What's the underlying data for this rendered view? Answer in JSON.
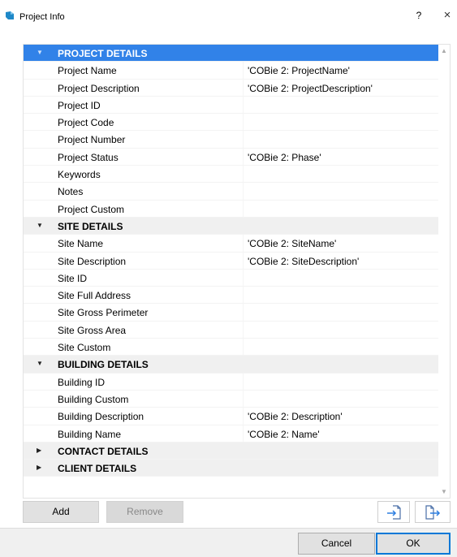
{
  "window": {
    "title": "Project Info",
    "help_label": "?",
    "close_label": "×"
  },
  "grid": {
    "sections": [
      {
        "title": "PROJECT DETAILS",
        "expanded": true,
        "selected": true,
        "rows": [
          {
            "label": "Project Name",
            "value": "'COBie 2: ProjectName'"
          },
          {
            "label": "Project Description",
            "value": "'COBie 2: ProjectDescription'"
          },
          {
            "label": "Project ID",
            "value": ""
          },
          {
            "label": "Project Code",
            "value": ""
          },
          {
            "label": "Project Number",
            "value": ""
          },
          {
            "label": "Project Status",
            "value": "'COBie 2: Phase'"
          },
          {
            "label": "Keywords",
            "value": ""
          },
          {
            "label": "Notes",
            "value": ""
          },
          {
            "label": "Project Custom",
            "value": ""
          }
        ]
      },
      {
        "title": "SITE DETAILS",
        "expanded": true,
        "selected": false,
        "rows": [
          {
            "label": "Site Name",
            "value": "'COBie 2: SiteName'"
          },
          {
            "label": "Site Description",
            "value": "'COBie 2: SiteDescription'"
          },
          {
            "label": "Site ID",
            "value": ""
          },
          {
            "label": "Site Full Address",
            "value": ""
          },
          {
            "label": "Site Gross Perimeter",
            "value": ""
          },
          {
            "label": "Site Gross Area",
            "value": ""
          },
          {
            "label": "Site Custom",
            "value": ""
          }
        ]
      },
      {
        "title": "BUILDING DETAILS",
        "expanded": true,
        "selected": false,
        "rows": [
          {
            "label": "Building ID",
            "value": ""
          },
          {
            "label": "Building Custom",
            "value": ""
          },
          {
            "label": "Building Description",
            "value": "'COBie 2: Description'"
          },
          {
            "label": "Building Name",
            "value": "'COBie 2: Name'"
          }
        ]
      },
      {
        "title": "CONTACT DETAILS",
        "expanded": false,
        "selected": false,
        "rows": []
      },
      {
        "title": "CLIENT DETAILS",
        "expanded": false,
        "selected": false,
        "rows": []
      }
    ]
  },
  "toolbar": {
    "add_label": "Add",
    "remove_label": "Remove",
    "import_icon": "import-icon",
    "export_icon": "export-icon"
  },
  "footer": {
    "cancel_label": "Cancel",
    "ok_label": "OK"
  },
  "colors": {
    "selection": "#3182e8",
    "section_bg": "#f0f0f0",
    "accent": "#0078d7"
  }
}
